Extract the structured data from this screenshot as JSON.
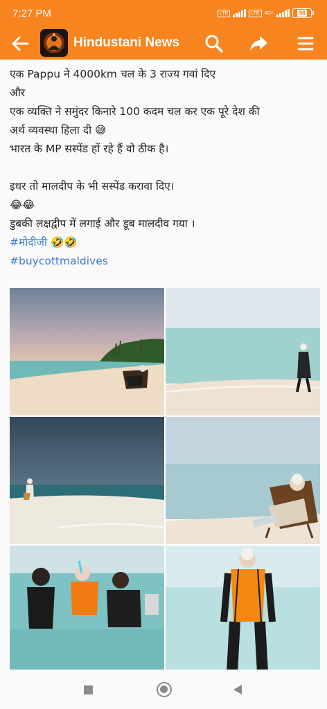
{
  "status_bar": {
    "time": "7:27 PM",
    "network_badge": "LTE",
    "network_speed": "4G+",
    "battery": "96"
  },
  "app_bar": {
    "title": "Hindustani News",
    "icons": [
      "back-arrow-icon",
      "search-icon",
      "share-icon",
      "menu-icon"
    ]
  },
  "post": {
    "lines": [
      "एक  Pappu ने 4000km चल के 3 राज्य गवां दिए",
      "और",
      "एक व्यक्ति ने समुंदर किनारे 100 कदम चल कर एक पूरे देश की",
      "अर्थ व्यवस्था हिला दी 😅",
      " भारत के MP सस्पेंड हों रहे हैं वो ठीक है।",
      "",
      "इधर तो मालदीप के भी सस्पेंड करावा दिए।",
      "😂😂",
      "डुबकी लक्षद्वीप में लगाई और डूब मालदीव गया ।"
    ],
    "hashtag_1": "#मोदीजी",
    "hashtag_1_suffix": " 🤣🤣",
    "hashtag_2": "#buycottmaldives"
  },
  "photos": [
    "beach-sitting-chair-photo",
    "beach-walking-photo",
    "beach-distant-walk-photo",
    "beach-reclining-chair-photo",
    "snorkeling-group-photo",
    "life-jacket-photo"
  ]
}
